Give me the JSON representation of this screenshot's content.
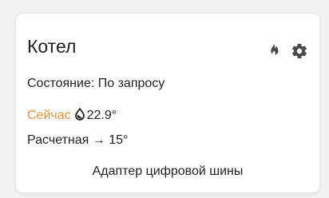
{
  "card": {
    "title": "Котел",
    "icons": [
      "flame-icon",
      "gear-icon"
    ],
    "status_label": "Состояние:",
    "status_value": "По запросу",
    "now_label": "Сейчас",
    "now_value": "22.9°",
    "calc_label": "Расчетная",
    "calc_arrow": "→",
    "calc_value": "15°",
    "footer": "Адаптер цифровой шины",
    "accent_color": "#e8933a"
  }
}
